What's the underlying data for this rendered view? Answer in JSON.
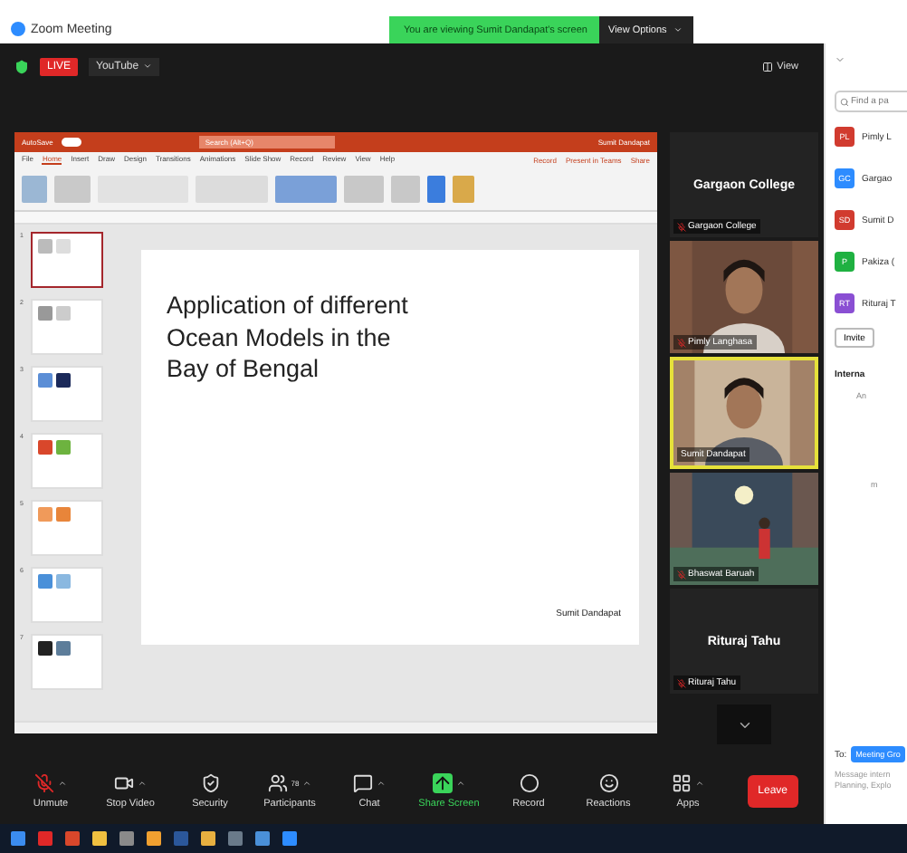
{
  "window": {
    "title": "Zoom Meeting"
  },
  "banner": {
    "text": "You are viewing Sumit Dandapat's screen",
    "button": "View Options"
  },
  "meeting_header": {
    "live": "LIVE",
    "stream": "YouTube",
    "view": "View"
  },
  "presentation": {
    "autosave": "AutoSave",
    "autosave_on": true,
    "search": "Search (Alt+Q)",
    "user": "Sumit Dandapat",
    "tabs": [
      {
        "label": "File",
        "selected": false
      },
      {
        "label": "Home",
        "selected": true
      },
      {
        "label": "Insert",
        "selected": false
      },
      {
        "label": "Draw",
        "selected": false
      },
      {
        "label": "Design",
        "selected": false
      },
      {
        "label": "Transitions",
        "selected": false
      },
      {
        "label": "Animations",
        "selected": false
      },
      {
        "label": "Slide Show",
        "selected": false
      },
      {
        "label": "Record",
        "selected": false
      },
      {
        "label": "Review",
        "selected": false
      },
      {
        "label": "View",
        "selected": false
      },
      {
        "label": "Help",
        "selected": false
      }
    ],
    "actions": [
      "Record",
      "Present in Teams",
      "Share"
    ],
    "slides": [
      {
        "number": "1",
        "selected": true
      },
      {
        "number": "2",
        "selected": false
      },
      {
        "number": "3",
        "selected": false
      },
      {
        "number": "4",
        "selected": false
      },
      {
        "number": "5",
        "selected": false
      },
      {
        "number": "6",
        "selected": false
      },
      {
        "number": "7",
        "selected": false
      }
    ],
    "slide": {
      "title": "Application of different Ocean Models in the Bay of Bengal",
      "author": "Sumit Dandapat"
    }
  },
  "gallery": [
    {
      "kind": "name",
      "title": "Gargaon College",
      "label": "Gargaon College",
      "muted": true,
      "active": false
    },
    {
      "kind": "video",
      "label": "Pimly Langhasa",
      "muted": true,
      "active": false
    },
    {
      "kind": "video",
      "label": "Sumit Dandapat",
      "muted": false,
      "active": true
    },
    {
      "kind": "video",
      "label": "Bhaswat Baruah",
      "muted": true,
      "active": false
    },
    {
      "kind": "name",
      "title": "Rituraj Tahu",
      "label": "Rituraj Tahu",
      "muted": true,
      "active": false
    }
  ],
  "toolbar": [
    {
      "label": "Unmute",
      "caret": true
    },
    {
      "label": "Stop Video",
      "caret": true
    },
    {
      "label": "Security",
      "caret": false
    },
    {
      "label": "Participants",
      "count": "78",
      "caret": true
    },
    {
      "label": "Chat",
      "caret": true
    },
    {
      "label": "Share Screen",
      "caret": true
    },
    {
      "label": "Record",
      "caret": false
    },
    {
      "label": "Reactions",
      "caret": false
    },
    {
      "label": "Apps",
      "caret": true
    }
  ],
  "leave": "Leave",
  "panel": {
    "search_placeholder": "Find a pa",
    "participants": [
      {
        "initials": "PL",
        "name": "Pimly L",
        "color": "#d13b2f"
      },
      {
        "initials": "GC",
        "name": "Gargao",
        "color": "#2d8cff"
      },
      {
        "initials": "SD",
        "name": "Sumit D",
        "color": "#d13b2f"
      },
      {
        "initials": "P",
        "name": "Pakiza (",
        "color": "#1fb141"
      },
      {
        "initials": "RT",
        "name": "Rituraj T",
        "color": "#8a4fd3"
      }
    ],
    "invite": "Invite",
    "chat_title": "Interna",
    "chat_lines": [
      "An",
      "m"
    ],
    "to": "To:",
    "recipient": "Meeting Gro",
    "message": [
      "Message intern",
      "Planning, Explo"
    ]
  }
}
